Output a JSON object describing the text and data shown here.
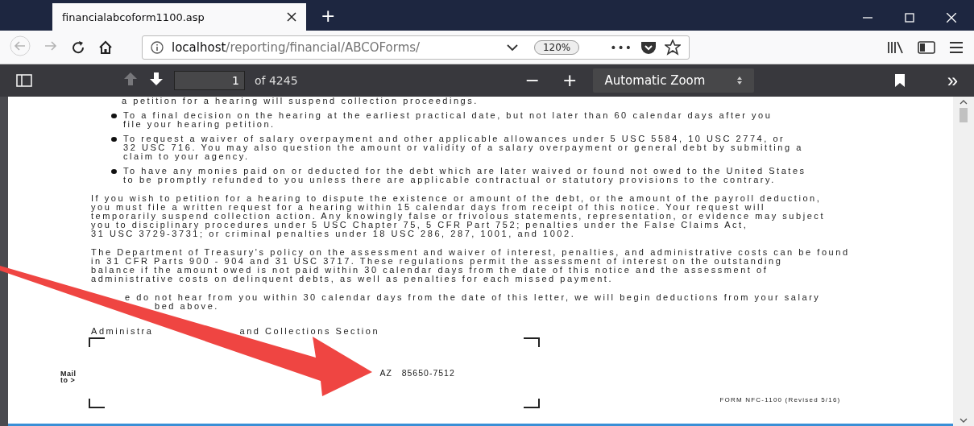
{
  "tabs": [
    {
      "title": "financialabcoform1100.asp",
      "selected": true
    }
  ],
  "new_tab": "+",
  "nav": {
    "back": {
      "disabled": true
    },
    "forward": {
      "disabled": true
    },
    "url_host": "localhost",
    "url_path": "/reporting/financial/ABCOForms/",
    "zoom_badge": "120%",
    "more": "•••"
  },
  "pdf_toolbar": {
    "prev_page": {
      "disabled": true
    },
    "next_page": {
      "disabled": false
    },
    "page": "1",
    "page_count": "of 4245",
    "zoom_out": "−",
    "zoom_in": "+",
    "zoom_select": "Automatic Zoom",
    "tools": "»"
  },
  "document": {
    "blocks": [
      {
        "kind": "continuation",
        "lines": [
          "a petition for a hearing will suspend collection proceedings."
        ]
      },
      {
        "kind": "bullet",
        "lines": [
          "To a final decision on the hearing at the earliest practical date, but not later than 60 calendar days after you",
          "file your hearing petition."
        ]
      },
      {
        "kind": "bullet",
        "lines": [
          "To request a waiver of salary overpayment and other applicable allowances under 5 USC 5584, 10 USC 2774, or",
          "32 USC 716.  You may also question the amount or validity of a salary overpayment or general debt by submitting a",
          "claim to your agency."
        ]
      },
      {
        "kind": "bullet",
        "lines": [
          "To have any monies paid on or deducted for the debt which are later waived or found not owed to the United States",
          "to be promptly refunded to you unless there are applicable contractual or statutory provisions to the contrary."
        ]
      },
      {
        "kind": "paragraph",
        "lines": [
          "If you wish to petition for a hearing to dispute the existence or amount of the debt, or the amount of the payroll deduction,",
          "you must file a written request for a hearing within 15 calendar days from receipt of this notice.  Your request will",
          "temporarily suspend collection action.  Any knowingly false or frivolous statements, representation, or evidence may subject",
          "you to disciplinary procedures under 5 USC Chapter 75, 5 CFR Part 752; penalties under the False Claims Act,",
          "31 USC 3729-3731; or criminal penalties under 18 USC 286, 287, 1001, and 1002."
        ]
      },
      {
        "kind": "paragraph",
        "lines": [
          "The Department of Treasury's policy on the assessment and waiver of interest, penalties, and administrative costs can be found",
          "in 31 CFR Parts 900 - 904 and 31 USC 3717.  These regulations permit the assessment of interest on the outstanding",
          "balance if the amount owed is not paid within 30 calendar days from the date of this notice and the assessment of",
          "administrative costs on delinquent debts, as well as penalties for each missed payment."
        ]
      },
      {
        "kind": "covered",
        "lines": [
          "e do not hear from you within 30 calendar days from the date of this letter, we will begin deductions from your salary",
          "bed above."
        ]
      },
      {
        "kind": "section",
        "lines": [
          "Administra",
          "and Collections Section"
        ]
      }
    ],
    "mail_label": "Mail\nto >",
    "mail_address": "AZ   85650-7512",
    "form_number": "FORM NFC-1100 (Revised 5/16)"
  }
}
